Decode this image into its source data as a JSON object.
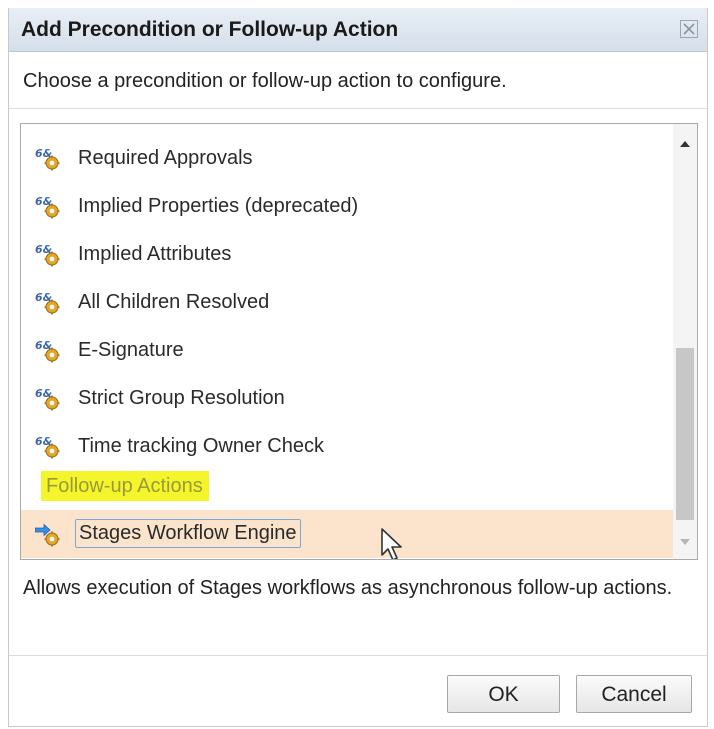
{
  "dialog": {
    "title": "Add Precondition or Follow-up Action",
    "close_icon": "close-x-icon",
    "instruction": "Choose a precondition or follow-up action to configure."
  },
  "list": {
    "items": [
      {
        "label": "Required Approvals",
        "icon": "precondition-gear-icon"
      },
      {
        "label": "Implied Properties (deprecated)",
        "icon": "precondition-gear-icon"
      },
      {
        "label": "Implied Attributes",
        "icon": "precondition-gear-icon"
      },
      {
        "label": "All Children Resolved",
        "icon": "precondition-gear-icon"
      },
      {
        "label": "E-Signature",
        "icon": "precondition-gear-icon"
      },
      {
        "label": "Strict Group Resolution",
        "icon": "precondition-gear-icon"
      },
      {
        "label": "Time tracking Owner Check",
        "icon": "precondition-gear-icon"
      }
    ],
    "group_header": "Follow-up Actions",
    "selected_item": {
      "label": "Stages Workflow Engine",
      "icon": "follow-up-action-arrow-gear-icon"
    },
    "highlight_color": "#f5f52c",
    "selection_color": "#fce4cc"
  },
  "description": "Allows execution of Stages workflows as asynchronous follow-up actions.",
  "buttons": {
    "ok": "OK",
    "cancel": "Cancel"
  }
}
